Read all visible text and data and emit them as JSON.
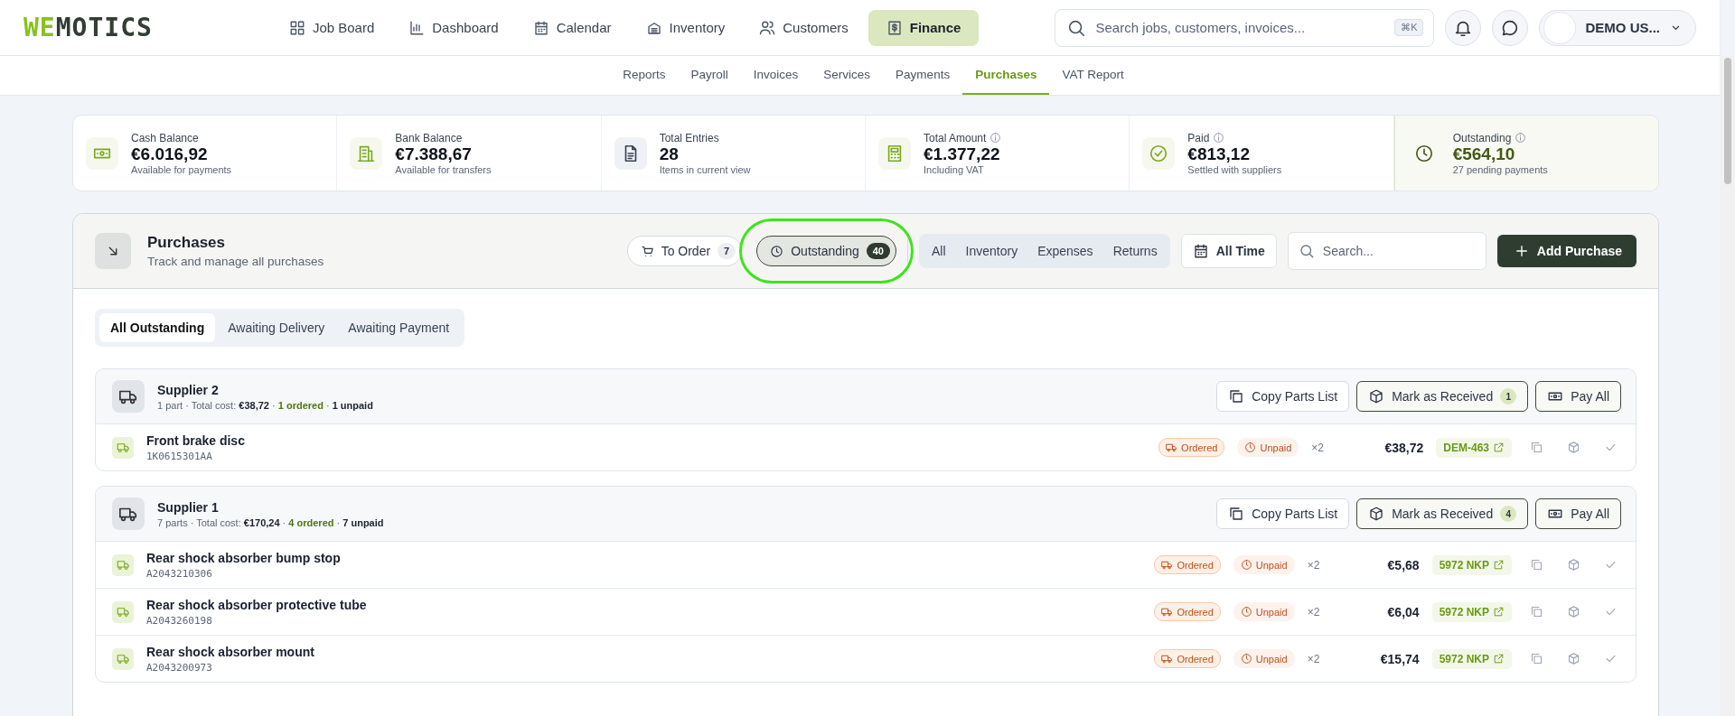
{
  "logo": {
    "accent": "WE",
    "rest": "MOTICS"
  },
  "main_nav": [
    {
      "label": "Job Board",
      "selected": false
    },
    {
      "label": "Dashboard",
      "selected": false
    },
    {
      "label": "Calendar",
      "selected": false
    },
    {
      "label": "Inventory",
      "selected": false
    },
    {
      "label": "Customers",
      "selected": false
    },
    {
      "label": "Finance",
      "selected": true
    }
  ],
  "global_search": {
    "placeholder": "Search jobs, customers, invoices...",
    "shortcut": "⌘K"
  },
  "user": {
    "name": "DEMO US..."
  },
  "sub_nav": [
    {
      "label": "Reports",
      "selected": false
    },
    {
      "label": "Payroll",
      "selected": false
    },
    {
      "label": "Invoices",
      "selected": false
    },
    {
      "label": "Services",
      "selected": false
    },
    {
      "label": "Payments",
      "selected": false
    },
    {
      "label": "Purchases",
      "selected": true
    },
    {
      "label": "VAT Report",
      "selected": false
    }
  ],
  "stats": [
    {
      "label": "Cash Balance",
      "info": false,
      "value": "€6.016,92",
      "note": "Available for payments",
      "highlighted": false
    },
    {
      "label": "Bank Balance",
      "info": false,
      "value": "€7.388,67",
      "note": "Available for transfers",
      "highlighted": false
    },
    {
      "label": "Total Entries",
      "info": false,
      "value": "28",
      "note": "Items in current view",
      "highlighted": false
    },
    {
      "label": "Total Amount",
      "info": true,
      "value": "€1.377,22",
      "note": "Including VAT",
      "highlighted": false
    },
    {
      "label": "Paid",
      "info": true,
      "value": "€813,12",
      "note": "Settled with suppliers",
      "highlighted": false
    },
    {
      "label": "Outstanding",
      "info": true,
      "value": "€564,10",
      "note": "27 pending payments",
      "highlighted": true
    }
  ],
  "purchases": {
    "title": "Purchases",
    "subtitle": "Track and manage all purchases",
    "toggles": [
      {
        "label": "To Order",
        "count": "7",
        "selected": false,
        "highlighted": false
      },
      {
        "label": "Outstanding",
        "count": "40",
        "selected": true,
        "highlighted": true
      }
    ],
    "type_filters": [
      {
        "label": "All",
        "selected": false
      },
      {
        "label": "Inventory",
        "selected": false
      },
      {
        "label": "Expenses",
        "selected": false
      },
      {
        "label": "Returns",
        "selected": false
      }
    ],
    "period": "All Time",
    "search": {
      "placeholder": "Search..."
    },
    "add_button": "Add Purchase",
    "sub_tabs": [
      {
        "label": "All Outstanding",
        "selected": true
      },
      {
        "label": "Awaiting Delivery",
        "selected": false
      },
      {
        "label": "Awaiting Payment",
        "selected": false
      }
    ],
    "groups": [
      {
        "supplier": "Supplier 2",
        "summary": [
          {
            "kind": "plain",
            "text": "1 part · Total cost: "
          },
          {
            "kind": "strong",
            "text": "€38,72"
          },
          {
            "kind": "plain",
            "text": " · "
          },
          {
            "kind": "ordered",
            "text": "1 ordered"
          },
          {
            "kind": "plain",
            "text": " · "
          },
          {
            "kind": "strong",
            "text": "1 unpaid"
          }
        ],
        "copy_button": "Copy Parts List",
        "receive_button": "Mark as Received",
        "receive_count": "1",
        "pay_button": "Pay All",
        "items": [
          {
            "name": "Front brake disc",
            "code": "1K0615301AA",
            "status": "Ordered",
            "payment": "Unpaid",
            "qty": "×2",
            "price": "€38,72",
            "ref": "DEM-463"
          }
        ]
      },
      {
        "supplier": "Supplier 1",
        "summary": [
          {
            "kind": "plain",
            "text": "7 parts · Total cost: "
          },
          {
            "kind": "strong",
            "text": "€170,24"
          },
          {
            "kind": "plain",
            "text": " · "
          },
          {
            "kind": "ordered",
            "text": "4 ordered"
          },
          {
            "kind": "plain",
            "text": " · "
          },
          {
            "kind": "strong",
            "text": "7 unpaid"
          }
        ],
        "copy_button": "Copy Parts List",
        "receive_button": "Mark as Received",
        "receive_count": "4",
        "pay_button": "Pay All",
        "items": [
          {
            "name": "Rear shock absorber bump stop",
            "code": "A2043210306",
            "status": "Ordered",
            "payment": "Unpaid",
            "qty": "×2",
            "price": "€5,68",
            "ref": "5972 NKP"
          },
          {
            "name": "Rear shock absorber protective tube",
            "code": "A2043260198",
            "status": "Ordered",
            "payment": "Unpaid",
            "qty": "×2",
            "price": "€6,04",
            "ref": "5972 NKP"
          },
          {
            "name": "Rear shock absorber mount",
            "code": "A2043200973",
            "status": "Ordered",
            "payment": "Unpaid",
            "qty": "×2",
            "price": "€15,74",
            "ref": "5972 NKP"
          }
        ]
      }
    ]
  }
}
